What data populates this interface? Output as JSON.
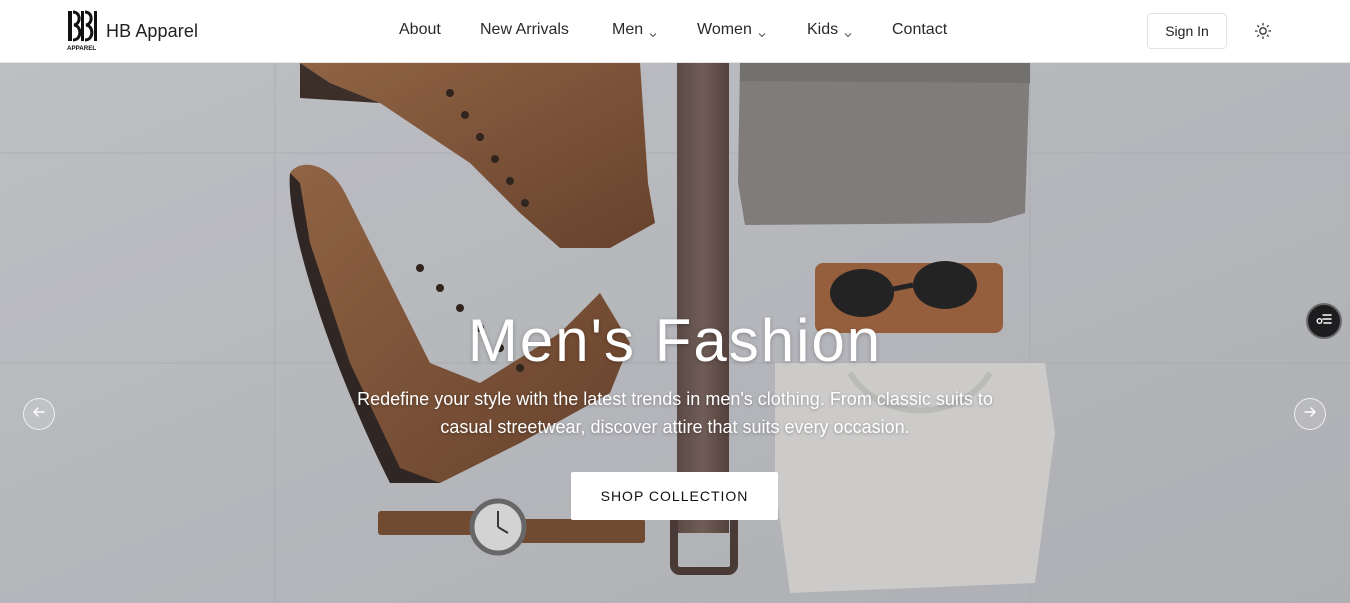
{
  "brand": {
    "logo_text": "HB",
    "logo_subtext": "APPAREL",
    "name": "HB Apparel"
  },
  "nav": {
    "items": [
      {
        "label": "About",
        "has_dropdown": false
      },
      {
        "label": "New Arrivals",
        "has_dropdown": false
      },
      {
        "label": "Men",
        "has_dropdown": true
      },
      {
        "label": "Women",
        "has_dropdown": true
      },
      {
        "label": "Kids",
        "has_dropdown": true
      },
      {
        "label": "Contact",
        "has_dropdown": false
      }
    ]
  },
  "header": {
    "sign_in_label": "Sign In",
    "theme_icon": "sun-icon"
  },
  "hero": {
    "title": "Men's Fashion",
    "description": "Redefine your style with the latest trends in men's clothing. From classic suits to casual streetwear, discover attire that suits every occasion.",
    "cta_label": "SHOP COLLECTION",
    "prev_icon": "arrow-left-icon",
    "next_icon": "arrow-right-icon"
  },
  "floating": {
    "icon": "settings-list-icon"
  },
  "colors": {
    "header_bg": "#ffffff",
    "hero_bg": "#c9cbcf",
    "leather": "#8b5a36",
    "text_dark": "#222222",
    "cta_bg": "#ffffff"
  }
}
